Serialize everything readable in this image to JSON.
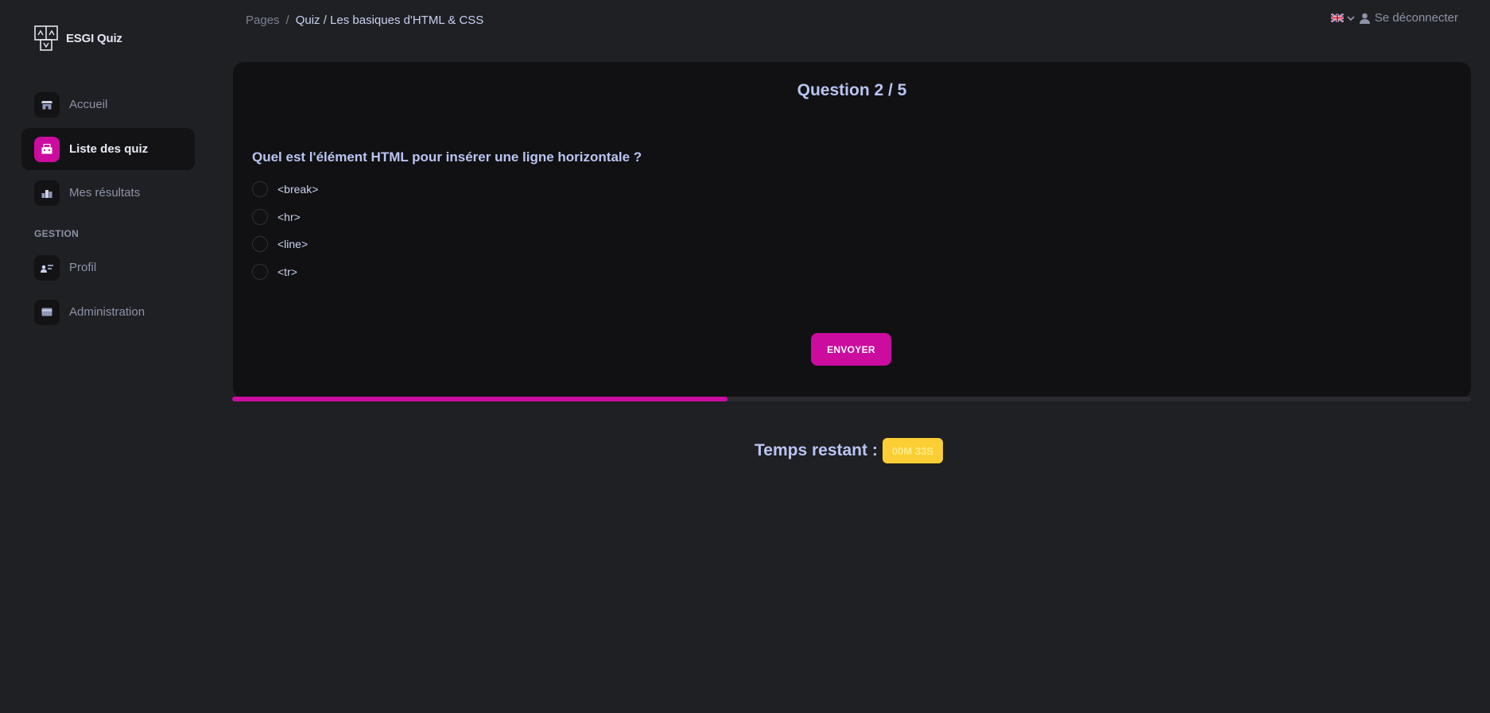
{
  "brand": {
    "name": "ESGI Quiz"
  },
  "sidebar": {
    "items": [
      {
        "label": "Accueil",
        "icon": "shop-icon"
      },
      {
        "label": "Liste des quiz",
        "icon": "office-icon",
        "active": true
      },
      {
        "label": "Mes résultats",
        "icon": "chart-icon"
      }
    ],
    "section_label": "GESTION",
    "gestion_items": [
      {
        "label": "Profil",
        "icon": "user-card-icon"
      },
      {
        "label": "Administration",
        "icon": "credit-card-icon"
      }
    ]
  },
  "breadcrumb": {
    "root": "Pages",
    "separator": "/",
    "current": "Quiz / Les basiques d'HTML & CSS"
  },
  "topbar": {
    "language_icon": "uk-flag-icon",
    "logout_label": "Se déconnecter"
  },
  "quiz": {
    "title": "Question 2 / 5",
    "question": "Quel est l'élément HTML pour insérer une ligne horizontale ?",
    "answers": [
      "<break>",
      "<hr>",
      "<line>",
      "<tr>"
    ],
    "submit_label": "ENVOYER",
    "progress": 0.4
  },
  "timer": {
    "label": "Temps restant :",
    "value": "00M 33S"
  },
  "colors": {
    "accent": "#cb0c9f",
    "warning": "#fbcf33",
    "background": "#1f2023",
    "card": "#111113"
  }
}
